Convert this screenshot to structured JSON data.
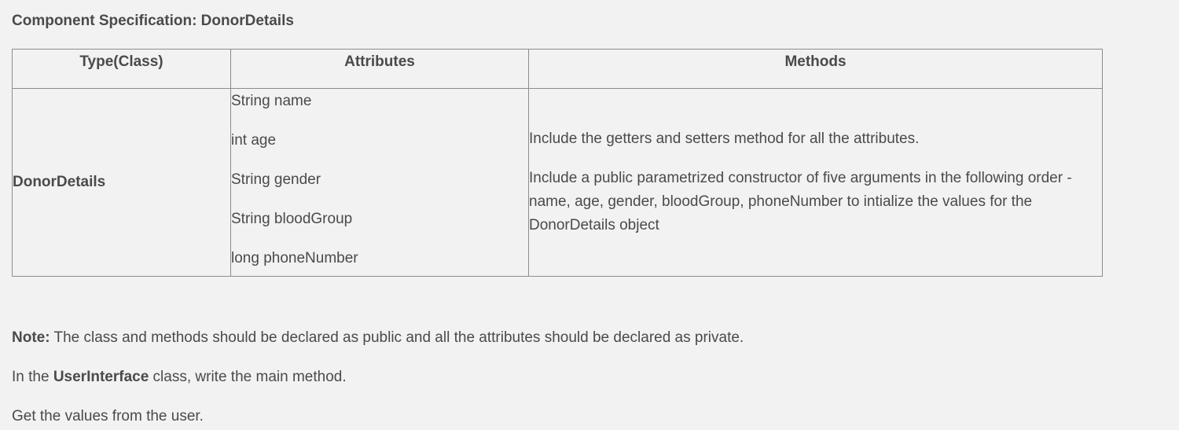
{
  "heading": "Component Specification: DonorDetails",
  "table": {
    "headers": [
      "Type(Class)",
      "Attributes",
      "Methods"
    ],
    "row": {
      "type": "DonorDetails",
      "attributes": [
        "String name",
        "int age",
        "String gender",
        "String bloodGroup",
        "long phoneNumber"
      ],
      "methods": [
        "Include the getters and setters method for all the attributes.",
        "Include a public parametrized constructor of five arguments in the following order - name, age, gender, bloodGroup,  phoneNumber to intialize the values for the DonorDetails object"
      ]
    }
  },
  "notes": {
    "note_label": "Note:",
    "note_text": " The class and methods should be declared as public and all the attributes should be declared as private.",
    "ui_prefix": "In the ",
    "ui_class": "UserInterface",
    "ui_suffix": " class, write the main method.",
    "get_values": "Get the values from the user."
  }
}
